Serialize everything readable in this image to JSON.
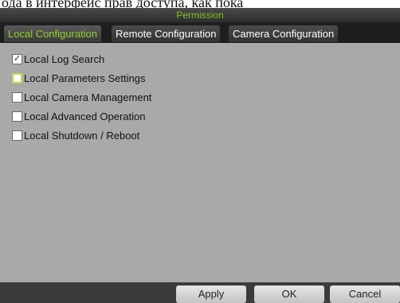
{
  "doc": {
    "text": "ода в интерфейс прав доступа, как пока"
  },
  "dialog": {
    "title": "Permission"
  },
  "tabs": [
    {
      "label": "Local Configuration",
      "active": true
    },
    {
      "label": "Remote Configuration",
      "active": false
    },
    {
      "label": "Camera Configuration",
      "active": false
    }
  ],
  "permissions": [
    {
      "label": "Local Log Search",
      "checked": true
    },
    {
      "label": "Local Parameters Settings",
      "checked": false
    },
    {
      "label": "Local Camera Management",
      "checked": false
    },
    {
      "label": "Local Advanced Operation",
      "checked": false
    },
    {
      "label": "Local Shutdown / Reboot",
      "checked": false
    }
  ],
  "buttons": {
    "apply": "Apply",
    "ok": "OK",
    "cancel": "Cancel"
  },
  "check_glyph": "✓",
  "colors": {
    "accent": "#8ed12a",
    "panel": "#a9a9a9",
    "tabbar": "#1e1e1e"
  }
}
